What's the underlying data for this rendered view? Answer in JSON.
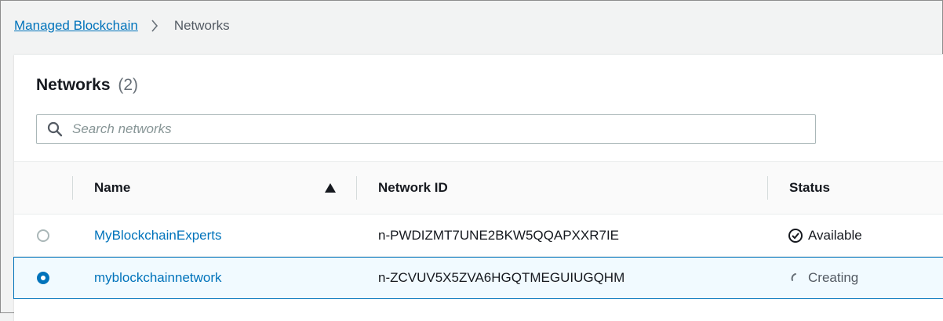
{
  "breadcrumb": {
    "parent": "Managed Blockchain",
    "current": "Networks"
  },
  "panel": {
    "title": "Networks",
    "count": "(2)"
  },
  "search": {
    "placeholder": "Search networks",
    "icon": "search-icon"
  },
  "table": {
    "columns": [
      "Name",
      "Network ID",
      "Status"
    ],
    "sort": {
      "column": "Name",
      "direction": "ascending"
    },
    "rows": [
      {
        "selected": false,
        "name": "MyBlockchainExperts",
        "network_id": "n-PWDIZMT7UNE2BKW5QQAPXXR7IE",
        "status": "Available",
        "status_icon": "check-circle-icon"
      },
      {
        "selected": true,
        "name": "myblockchainnetwork",
        "network_id": "n-ZCVUV5X5ZVA6HGQTMEGUIUGQHM",
        "status": "Creating",
        "status_icon": "spinner-icon"
      }
    ]
  },
  "colors": {
    "link": "#0073bb",
    "selected_row_bg": "#f1faff",
    "page_bg": "#f2f3f3"
  }
}
